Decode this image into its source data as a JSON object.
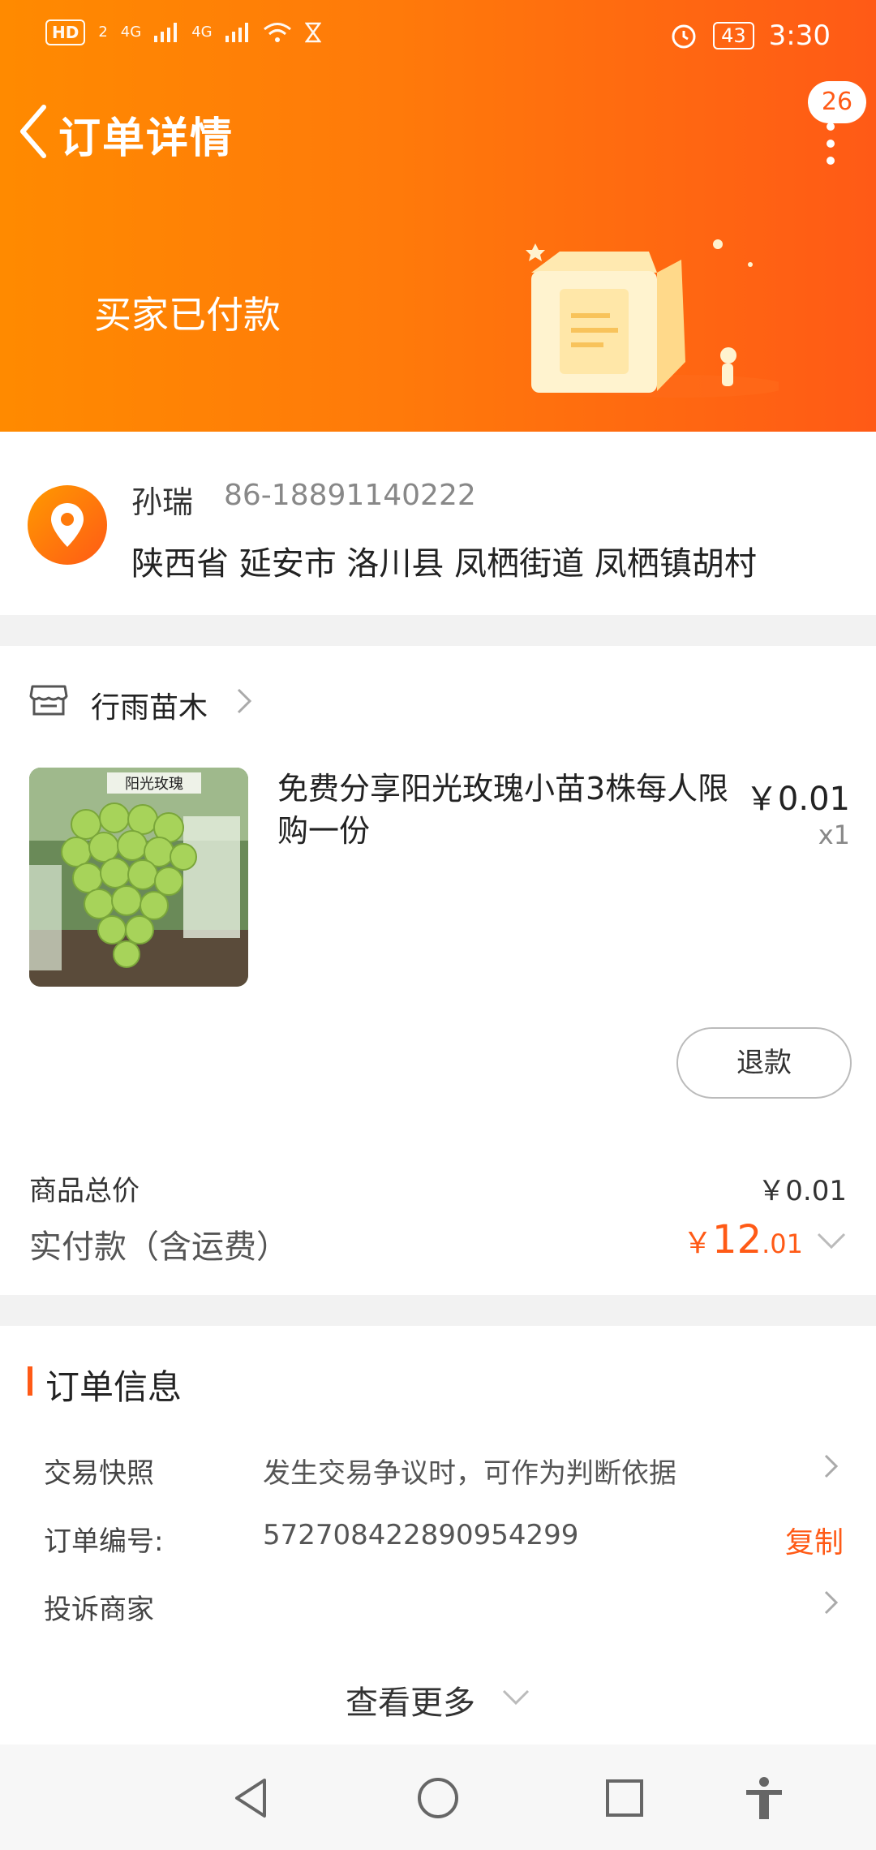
{
  "status_bar": {
    "hd": "HD",
    "hd_sub": "2",
    "sig1": "4G",
    "sig2": "4G",
    "battery": "43",
    "time": "3:30"
  },
  "header": {
    "title": "订单详情",
    "message_count": "26",
    "status": "买家已付款"
  },
  "address": {
    "name": "孙瑞",
    "phone": "86-18891140222",
    "full": "陕西省 延安市 洛川县 凤栖街道 凤栖镇胡村"
  },
  "store": {
    "name": "行雨苗木"
  },
  "product": {
    "image_text": "阳光玫瑰",
    "title": "免费分享阳光玫瑰小苗3株每人限购一份",
    "price": "￥0.01",
    "qty": "x1",
    "refund_label": "退款"
  },
  "totals": {
    "goods_label": "商品总价",
    "goods_value": "￥0.01",
    "paid_label": "实付款（含运费）",
    "paid_currency": "￥",
    "paid_int": "12",
    "paid_dec": ".01"
  },
  "order_info": {
    "title": "订单信息",
    "snapshot_label": "交易快照",
    "snapshot_value": "发生交易争议时，可作为判断依据",
    "order_no_label": "订单编号:",
    "order_no_value": "572708422890954299",
    "copy_label": "复制",
    "complaint_label": "投诉商家",
    "see_more": "查看更多"
  },
  "colors": {
    "accent": "#ff5a16",
    "header_start": "#ff8a00",
    "header_end": "#ff5a16"
  }
}
